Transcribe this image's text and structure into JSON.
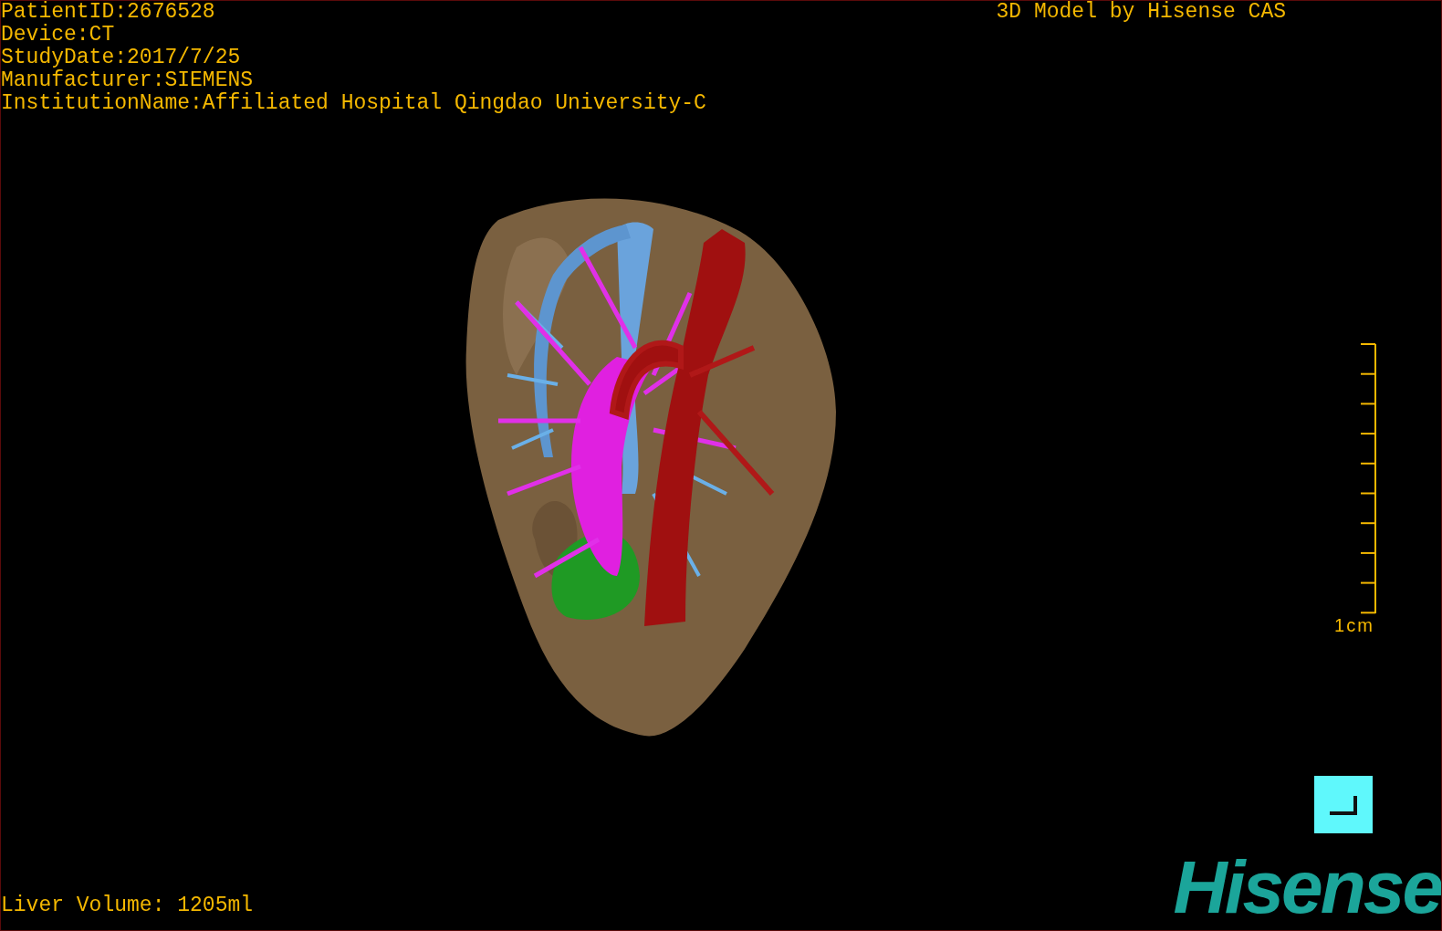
{
  "patient_info": [
    "PatientID:2676528",
    "Device:CT",
    "StudyDate:2017/7/25",
    "Manufacturer:SIEMENS",
    "InstitutionName:Affiliated Hospital Qingdao University-C"
  ],
  "model_credit": "3D Model by Hisense CAS",
  "scale_bar": {
    "label": "1cm"
  },
  "liver_volume": "Liver Volume: 1205ml",
  "logo": "Hisense"
}
